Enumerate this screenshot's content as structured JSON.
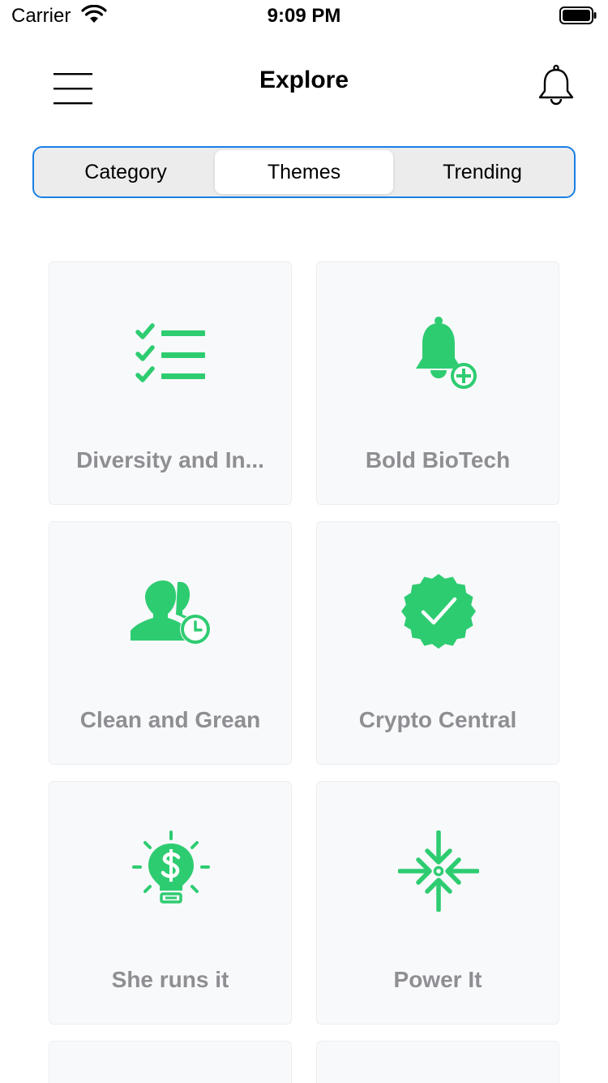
{
  "status_bar": {
    "carrier": "Carrier",
    "time": "9:09 PM"
  },
  "nav": {
    "title": "Explore",
    "menu_icon": "hamburger-menu-icon",
    "notification_icon": "bell-icon"
  },
  "tabs": [
    {
      "label": "Category",
      "active": false
    },
    {
      "label": "Themes",
      "active": true
    },
    {
      "label": "Trending",
      "active": false
    }
  ],
  "themes": [
    {
      "label": "Diversity and In...",
      "icon": "checklist-icon"
    },
    {
      "label": "Bold BioTech",
      "icon": "bell-plus-icon"
    },
    {
      "label": "Clean and Grean",
      "icon": "users-clock-icon"
    },
    {
      "label": "Crypto Central",
      "icon": "verified-badge-icon"
    },
    {
      "label": "She runs it",
      "icon": "dollar-bulb-icon"
    },
    {
      "label": "Power It",
      "icon": "focus-arrows-icon"
    }
  ],
  "colors": {
    "accent_green": "#2ecc71",
    "segment_border": "#1a7fe6",
    "card_bg": "#f8f9fb",
    "label_gray": "#8e8e93"
  }
}
